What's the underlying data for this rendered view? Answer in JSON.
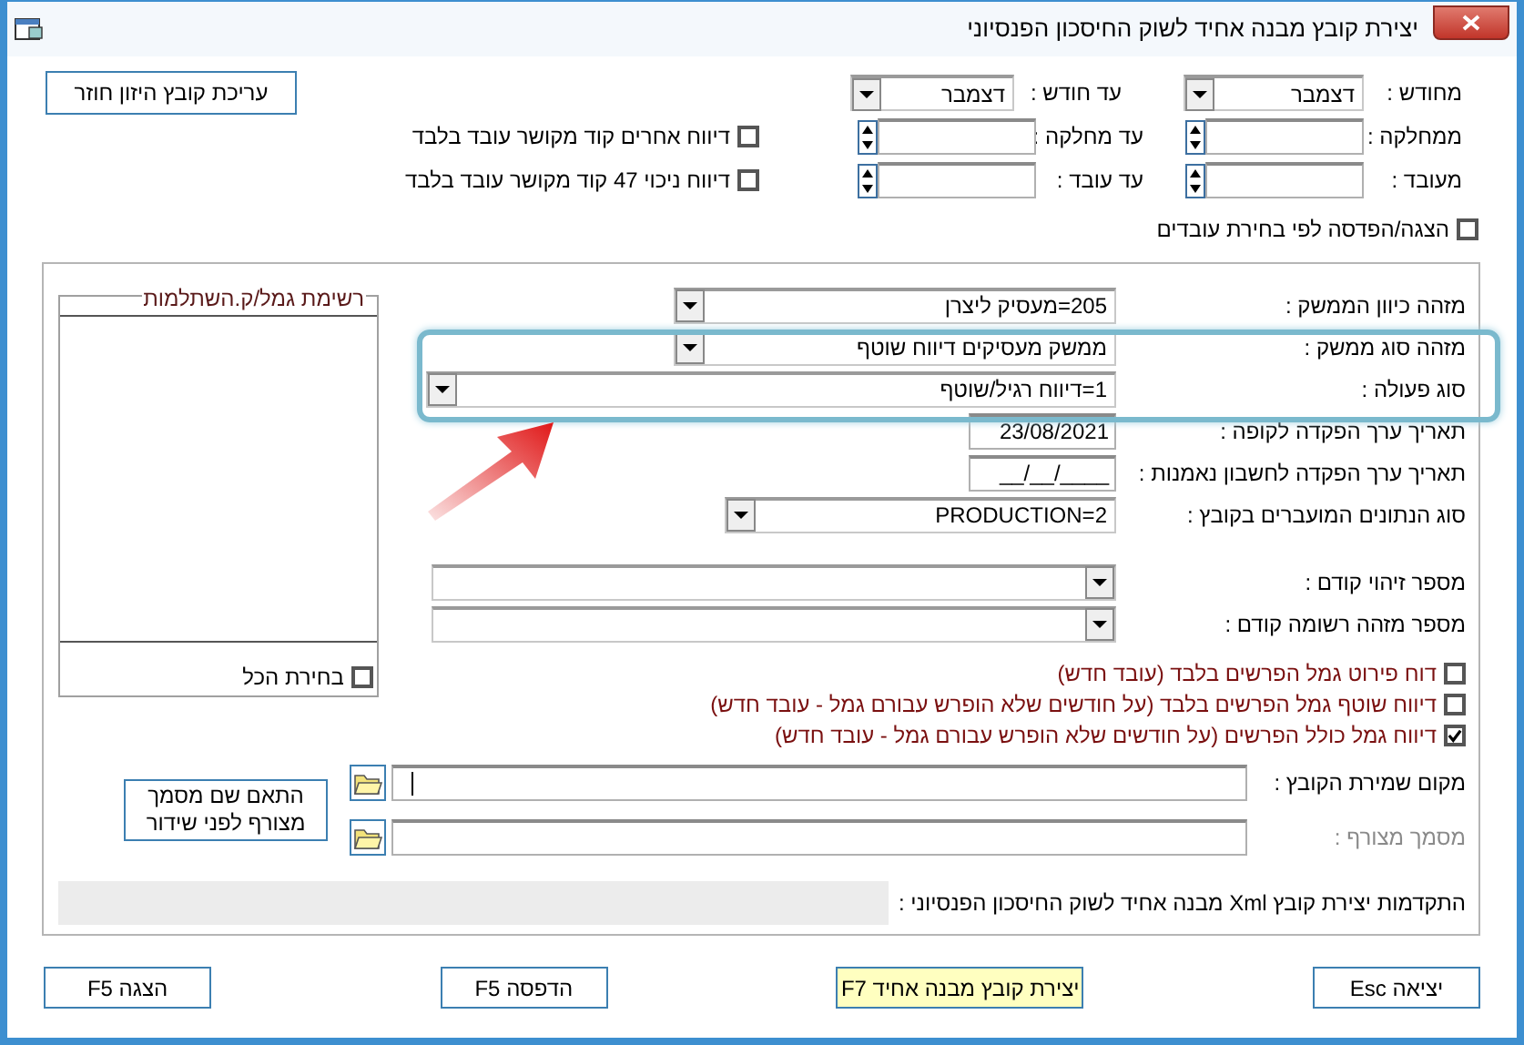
{
  "window": {
    "title": "יצירת קובץ מבנה אחיד לשוק החיסכון הפנסיוני"
  },
  "period": {
    "from_label": "מחודש :",
    "from_value": "דצמבר",
    "to_label": "עד חודש :",
    "to_value": "דצמבר"
  },
  "range_rows": [
    {
      "from_label": "ממחלקה :",
      "to_label": "עד מחלקה :"
    },
    {
      "from_label": "מעובד :",
      "to_label": "עד עובד :"
    }
  ],
  "feedback_button": "עריכת קובץ היזון חוזר",
  "side_checks": [
    {
      "label": "דיווח אחרים קוד מקושר עובד בלבד",
      "checked": false
    },
    {
      "label": "דיווח ניכוי 47 קוד מקושר עובד בלבד",
      "checked": false
    }
  ],
  "employee_selection": {
    "label": "הצגה/הפדסה לפי בחירת עובדים",
    "checked": false
  },
  "fund_list": {
    "title": "רשימת גמל/ק.השתלמות",
    "select_all": {
      "label": "בחירת הכל",
      "checked": false
    }
  },
  "fields": [
    {
      "kind": "combo",
      "label": "מזהה כיוון הממשק :",
      "value": "205=מעסיק ליצרן"
    },
    {
      "kind": "combo",
      "label": "מזהה סוג ממשק :",
      "value": "ממשק מעסיקים דיווח שוטף"
    },
    {
      "kind": "wide_combo",
      "label": "סוג פעולה :",
      "value": "1=דיווח רגיל/שוטף"
    },
    {
      "kind": "date",
      "label": "תאריך ערך הפקדה לקופה :",
      "value": "23/08/2021"
    },
    {
      "kind": "date",
      "label": "תאריך ערך הפקדה לחשבון נאמנות :",
      "value": "__/__/____"
    },
    {
      "kind": "short_combo",
      "label": "סוג הנתונים המועברים בקובץ :",
      "value": "PRODUCTION=2"
    },
    {
      "kind": "dropdown",
      "label": "מספר זיהוי קודם :"
    },
    {
      "kind": "dropdown",
      "label": "מספר מזהה רשומה קודם :"
    }
  ],
  "reports": [
    {
      "label": "דוח פירוט גמל הפרשים בלבד (עובד חדש)",
      "checked": false
    },
    {
      "label": "דיווח שוטף גמל הפרשים בלבד (על חודשים שלא הופרש עבורם גמל - עובד חדש)",
      "checked": false
    },
    {
      "label": "דיווח גמל כולל הפרשים (על חודשים שלא הופרש עבורם גמל - עובד חדש)",
      "checked": true
    }
  ],
  "file_location": {
    "label": "מקום שמירת הקובץ :"
  },
  "attachment": {
    "label": "מסמך מצורף :",
    "disabled": true
  },
  "match_button": "התאם שם מסמך מצורף לפני שידור",
  "progress": {
    "label": "התקדמות יצירת קובץ Xml מבנה אחיד לשוק החיסכון הפנסיוני :",
    "level": 0
  },
  "buttons": [
    {
      "label": "יציאה Esc",
      "kind": "plain"
    },
    {
      "label": "יצירת קובץ מבנה אחיד F7",
      "kind": "primary"
    },
    {
      "label": "הדפסה F5",
      "kind": "plain"
    },
    {
      "label": "הצגה F5",
      "kind": "plain"
    }
  ]
}
